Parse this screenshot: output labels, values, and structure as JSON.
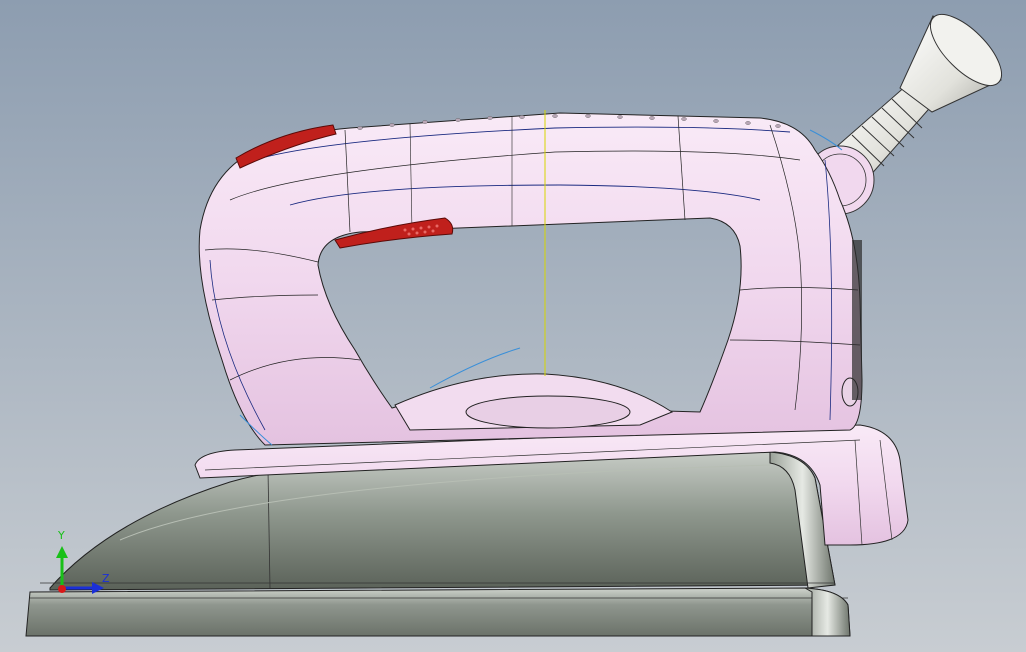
{
  "viewport": {
    "background_top": "#8d9db0",
    "background_bottom": "#c8cdd2"
  },
  "model": {
    "body_color": "#f3dcf0",
    "soleplate_color": "#8c968a",
    "accent_color": "#c0201c",
    "nozzle_color": "#ebebe6"
  },
  "triad": {
    "y_label": "Y",
    "z_label": "Z",
    "y_color": "#18c018",
    "z_color": "#1a2fd8",
    "x_color": "#d81818"
  }
}
